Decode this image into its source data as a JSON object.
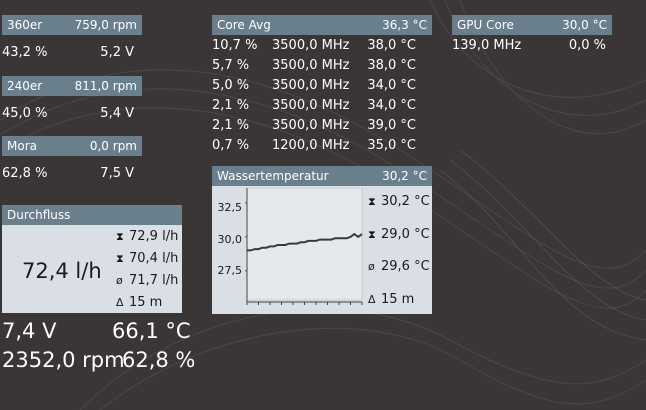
{
  "fans": [
    {
      "name": "360er",
      "rpm": "759,0 rpm",
      "left": "43,2 %",
      "right": "5,2 V"
    },
    {
      "name": "240er",
      "rpm": "811,0 rpm",
      "left": "45,0 %",
      "right": "5,4 V"
    },
    {
      "name": "Mora",
      "rpm": "0,0 rpm",
      "left": "62,8 %",
      "right": "7,5 V"
    }
  ],
  "flow": {
    "title": "Durchfluss",
    "value": "72,4 l/h",
    "max": "72,9 l/h",
    "min": "70,4 l/h",
    "avg": "71,7 l/h",
    "time": "15 m"
  },
  "pump": {
    "voltage": "7,4 V",
    "temp": "66,1 °C",
    "rpm": "2352,0 rpm",
    "percent": "62,8 %"
  },
  "cpu": {
    "title": "Core Avg",
    "temp": "36,3 °C",
    "rows": [
      [
        "10,7 %",
        "3500,0 MHz",
        "38,0 °C"
      ],
      [
        "5,7 %",
        "3500,0 MHz",
        "38,0 °C"
      ],
      [
        "5,0 %",
        "3500,0 MHz",
        "34,0 °C"
      ],
      [
        "2,1 %",
        "3500,0 MHz",
        "34,0 °C"
      ],
      [
        "2,1 %",
        "3500,0 MHz",
        "39,0 °C"
      ],
      [
        "0,7 %",
        "1200,0 MHz",
        "35,0 °C"
      ]
    ]
  },
  "gpu": {
    "title": "GPU Core",
    "temp": "30,0 °C",
    "clock": "139,0 MHz",
    "load": "0,0 %"
  },
  "water": {
    "title": "Wassertemperatur",
    "temp": "30,2 °C",
    "max": "30,2 °C",
    "min": "29,0 °C",
    "avg": "29,6 °C",
    "time": "15 m"
  },
  "chart_data": {
    "type": "line",
    "title": "",
    "xlabel": "",
    "ylabel": "",
    "y_ticks": [
      "32,5",
      "30,0",
      "27,5"
    ],
    "ylim": [
      25.2,
      33.6
    ],
    "x": [
      0,
      1,
      2,
      3,
      4,
      5,
      6,
      7,
      8,
      9,
      10,
      11,
      12,
      13,
      14,
      15,
      16,
      17,
      18,
      19,
      20,
      21,
      22,
      23,
      24,
      25,
      26,
      27,
      28,
      29,
      30
    ],
    "values": [
      29.0,
      29.0,
      29.1,
      29.1,
      29.2,
      29.2,
      29.3,
      29.3,
      29.4,
      29.4,
      29.4,
      29.5,
      29.5,
      29.5,
      29.6,
      29.6,
      29.7,
      29.7,
      29.7,
      29.8,
      29.8,
      29.8,
      29.8,
      29.9,
      29.9,
      29.9,
      29.9,
      30.0,
      30.2,
      30.0,
      30.2
    ],
    "grid": false,
    "colors": {
      "line": "#3a3a3a",
      "plot_bg": "#e4e9ec"
    }
  },
  "icons": {
    "max": "max-arrow-icon",
    "min": "min-arrow-icon",
    "avg": "average-icon",
    "time": "delta-time-icon"
  }
}
